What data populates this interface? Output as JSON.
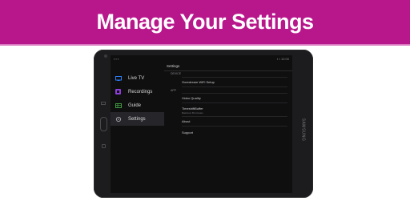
{
  "banner": {
    "title": "Manage Your Settings"
  },
  "device": {
    "brand": "SAMSUNG"
  },
  "statusbar": {
    "left": "▪ ▪ ▪",
    "right": "▪ ▪ 12:00"
  },
  "sidebar": {
    "items": [
      {
        "label": "Live TV",
        "icon": "tv-icon",
        "color": "#2d7ff9"
      },
      {
        "label": "Recordings",
        "icon": "recordings-icon",
        "color": "#8b3fd6"
      },
      {
        "label": "Guide",
        "icon": "guide-icon",
        "color": "#3f9a3f"
      },
      {
        "label": "Settings",
        "icon": "settings-gear-icon",
        "color": "#9a9aa0",
        "active": true
      }
    ]
  },
  "content": {
    "title": "Settings",
    "sections": [
      {
        "label": "DEVICE"
      },
      {
        "label": "APP"
      }
    ],
    "rows": [
      {
        "label": "Ooredream WiFi Setup",
        "sub": ""
      },
      {
        "label": "Video Quality",
        "sub": ""
      },
      {
        "label": "TimeshiftBuffer",
        "sub": "Maximum 60 minutes"
      },
      {
        "label": "About",
        "sub": ""
      },
      {
        "label": "Support",
        "sub": ""
      }
    ]
  }
}
